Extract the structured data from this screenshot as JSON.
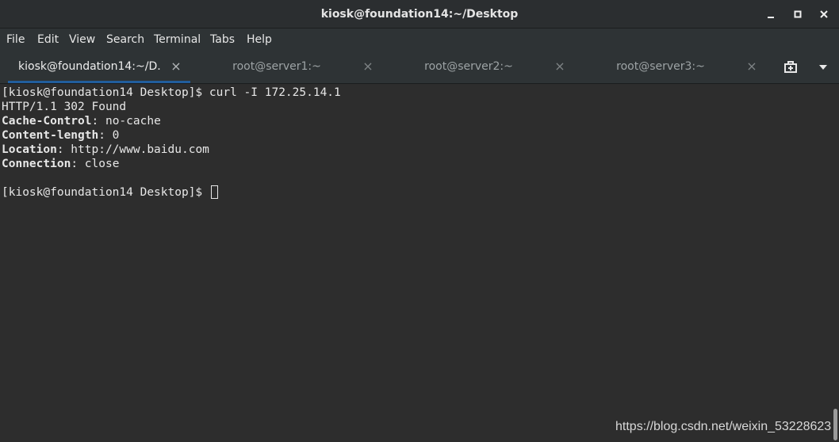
{
  "window": {
    "title": "kiosk@foundation14:~/Desktop",
    "minimize_icon": "minimize-icon",
    "maximize_icon": "maximize-icon",
    "close_icon": "close-icon"
  },
  "menu": {
    "items": [
      "File",
      "Edit",
      "View",
      "Search",
      "Terminal",
      "Tabs",
      "Help"
    ]
  },
  "tabs": [
    {
      "label": "kiosk@foundation14:~/D...",
      "active": true
    },
    {
      "label": "root@server1:~",
      "active": false
    },
    {
      "label": "root@server2:~",
      "active": false
    },
    {
      "label": "root@server3:~",
      "active": false
    }
  ],
  "tab_close_glyph": "×",
  "tabbar_icons": {
    "new_tab": "new-tab-icon",
    "menu": "dropdown-arrow-icon"
  },
  "terminal": {
    "prompt": "[kiosk@foundation14 Desktop]$ ",
    "command": "curl -I 172.25.14.1",
    "status_line": "HTTP/1.1 302 Found",
    "headers": [
      {
        "name": "Cache-Control",
        "value": ": no-cache"
      },
      {
        "name": "Content-length",
        "value": ": 0"
      },
      {
        "name": "Location",
        "value": ": http://www.baidu.com"
      },
      {
        "name": "Connection",
        "value": ": close"
      }
    ],
    "final_prompt": "[kiosk@foundation14 Desktop]$ "
  },
  "watermark": "https://blog.csdn.net/weixin_53228623",
  "colors": {
    "terminal_bg": "#2d2d2d",
    "terminal_fg": "#e7e7e7",
    "active_tab_underline": "#215d9c"
  }
}
